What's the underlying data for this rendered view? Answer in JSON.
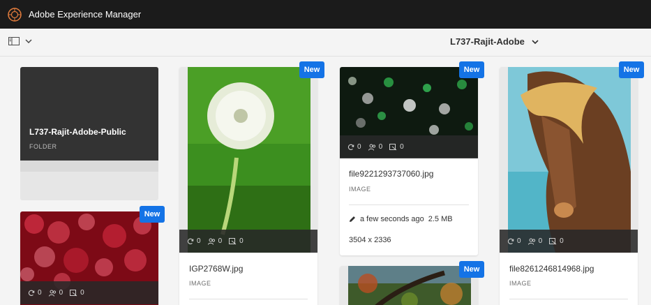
{
  "header": {
    "app_title": "Adobe Experience Manager",
    "logo_icon": "adobe-aem-logo"
  },
  "toolbar": {
    "rail_icon": "panel-icon",
    "location": "L737-Rajit-Adobe"
  },
  "folder": {
    "name": "L737-Rajit-Adobe-Public",
    "type": "FOLDER"
  },
  "badge_text": "New",
  "assets": [
    {
      "name": "file9221293737060.jpg",
      "type": "IMAGE",
      "modified": "a few seconds ago",
      "size": "2.5 MB",
      "dimensions": "3504 x 2336",
      "versions": "0",
      "comments": "0",
      "tasks": "0"
    },
    {
      "name": "IGP2768W.jpg",
      "type": "IMAGE",
      "versions": "0",
      "comments": "0",
      "tasks": "0"
    },
    {
      "name": "file8261246814968.jpg",
      "type": "IMAGE",
      "versions": "0",
      "comments": "0",
      "tasks": "0"
    },
    {
      "versions": "0",
      "comments": "0",
      "tasks": "0"
    }
  ],
  "colors": {
    "accent": "#1473e6",
    "topbar": "#1b1b1b",
    "background": "#f4f4f4"
  }
}
